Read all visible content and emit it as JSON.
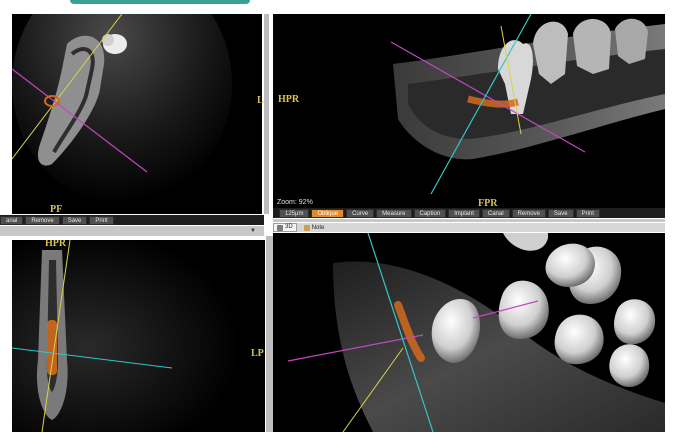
{
  "header": {
    "accent_color": "#3aa197"
  },
  "views": {
    "top_left": {
      "label": "PF",
      "side_label": "L"
    },
    "top_right": {
      "label": "HPR",
      "bottom_label": "FPR"
    },
    "bottom_left": {
      "label": "HPR"
    },
    "bottom_right": {
      "side_label": "LP"
    }
  },
  "toolbar_left": {
    "buttons": [
      "anal",
      "Remove",
      "Save",
      "Print"
    ]
  },
  "toolbar_right": {
    "zoom": "Zoom: 92%",
    "buttons": [
      "125μm",
      "Oblique",
      "Curve",
      "Measure",
      "Caption",
      "Implant",
      "Canal",
      "Remove",
      "Save",
      "Print"
    ],
    "active_index": 1
  },
  "tabs": [
    {
      "label": "3D",
      "icon": "view-3d-icon"
    },
    {
      "label": "Note",
      "icon": "note-icon"
    }
  ],
  "colors": {
    "axis_yellow": "#d8d44a",
    "axis_cyan": "#35c6c6",
    "axis_magenta": "#c447c4",
    "canal_orange": "#d06a1e",
    "accent_orange": "#e08a2c"
  }
}
